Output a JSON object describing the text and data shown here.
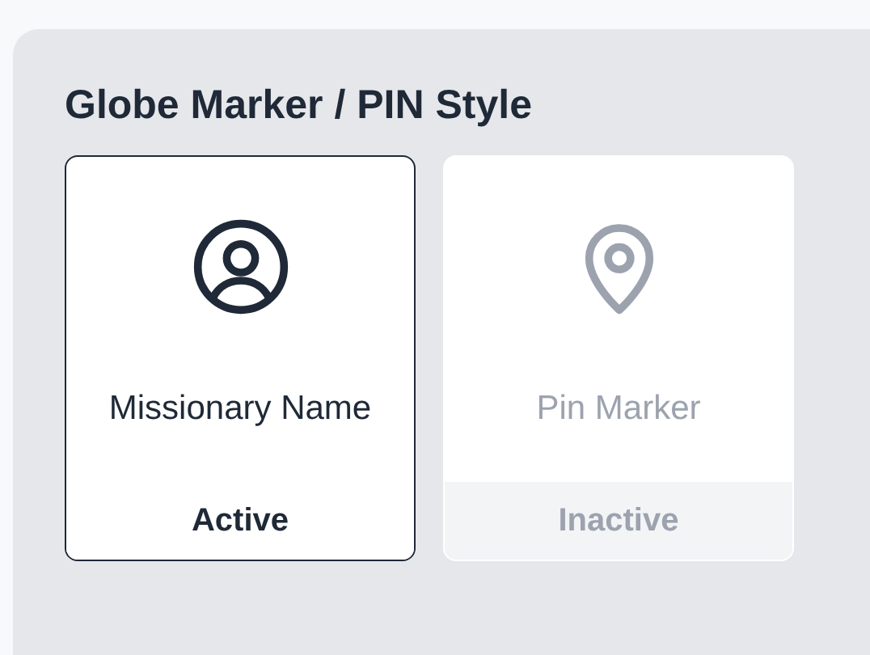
{
  "section": {
    "title": "Globe Marker / PIN Style"
  },
  "options": [
    {
      "kind": "person",
      "label": "Missionary Name",
      "status": "Active",
      "selected": true
    },
    {
      "kind": "pin",
      "label": "Pin Marker",
      "status": "Inactive",
      "selected": false
    }
  ]
}
